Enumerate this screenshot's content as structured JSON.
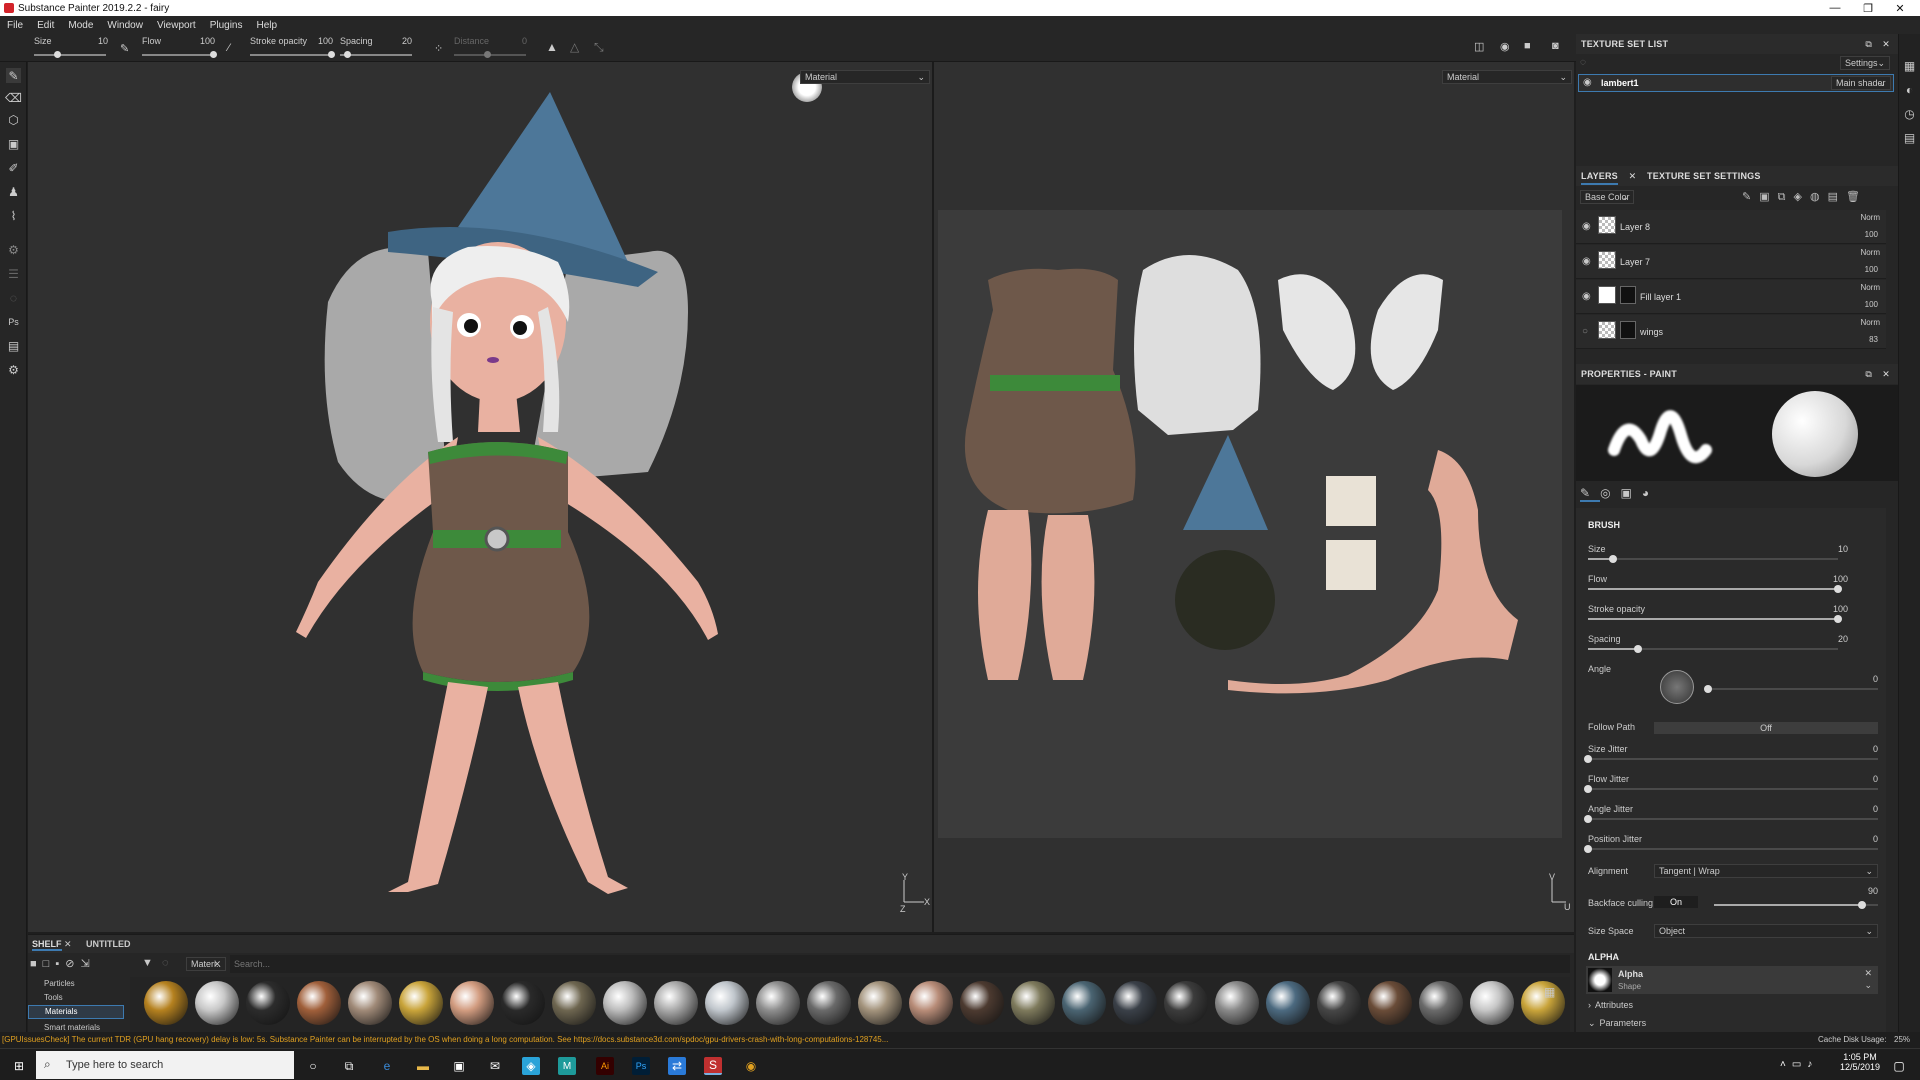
{
  "window": {
    "title": "Substance Painter 2019.2.2 - fairy",
    "minimize": "—",
    "maximize": "❐",
    "close": "✕"
  },
  "menu": [
    "File",
    "Edit",
    "Mode",
    "Window",
    "Viewport",
    "Plugins",
    "Help"
  ],
  "toolbar": {
    "size_label": "Size",
    "size_value": "10",
    "flow_label": "Flow",
    "flow_value": "100",
    "stroke_opacity_label": "Stroke opacity",
    "stroke_opacity_value": "100",
    "spacing_label": "Spacing",
    "spacing_value": "20",
    "distance_label": "Distance",
    "distance_value": "0"
  },
  "viewport": {
    "left_dropdown": "Material",
    "right_dropdown": "Material",
    "axis_y": "Y",
    "axis_x": "X",
    "axis_z": "Z",
    "axis_v": "V",
    "axis_u": "U"
  },
  "texture_set_list": {
    "title": "TEXTURE SET LIST",
    "settings_button": "Settings",
    "item_name": "lambert1",
    "shader": "Main shader"
  },
  "layers_panel": {
    "tab_layers": "LAYERS",
    "tab_settings": "TEXTURE SET SETTINGS",
    "channel": "Base Color",
    "layers": [
      {
        "name": "Layer 8",
        "blend": "Norm",
        "opacity": "100"
      },
      {
        "name": "Layer 7",
        "blend": "Norm",
        "opacity": "100"
      },
      {
        "name": "Fill layer 1",
        "blend": "Norm",
        "opacity": "100"
      },
      {
        "name": "wings",
        "blend": "Norm",
        "opacity": "83"
      }
    ]
  },
  "properties": {
    "title": "PROPERTIES - PAINT",
    "brush_header": "BRUSH",
    "size": {
      "label": "Size",
      "value": "10",
      "fraction": 0.1
    },
    "flow": {
      "label": "Flow",
      "value": "100",
      "fraction": 1.0
    },
    "stroke_opacity": {
      "label": "Stroke opacity",
      "value": "100",
      "fraction": 1.0
    },
    "spacing": {
      "label": "Spacing",
      "value": "20",
      "fraction": 0.2
    },
    "angle": {
      "label": "Angle",
      "value": "0"
    },
    "follow_path": {
      "label": "Follow Path",
      "value": "Off"
    },
    "size_jitter": {
      "label": "Size Jitter",
      "value": "0"
    },
    "flow_jitter": {
      "label": "Flow Jitter",
      "value": "0"
    },
    "angle_jitter": {
      "label": "Angle Jitter",
      "value": "0"
    },
    "position_jitter": {
      "label": "Position Jitter",
      "value": "0"
    },
    "alignment": {
      "label": "Alignment",
      "value": "Tangent | Wrap"
    },
    "backface": {
      "label": "Backface culling",
      "toggle": "On",
      "value": "90",
      "fraction": 0.9
    },
    "size_space": {
      "label": "Size Space",
      "value": "Object"
    },
    "alpha_header": "ALPHA",
    "alpha_name": "Alpha",
    "alpha_type": "Shape",
    "attributes": "Attributes",
    "parameters": "Parameters"
  },
  "shelf": {
    "tab_shelf": "SHELF",
    "tab_untitled": "UNTITLED",
    "filter_tag": "Materi..",
    "search_placeholder": "Search...",
    "categories": [
      "Particles",
      "Tools",
      "Materials",
      "Smart materials"
    ],
    "materials": [
      "#b5811f",
      "#c8c8c8",
      "#2c2c2c",
      "#a05f3a",
      "#a08a78",
      "#c9a43a",
      "#d29c80",
      "#2a2a2a",
      "#6e6650",
      "#bcbcbc",
      "#aaaaaa",
      "#c0c6cc",
      "#8e8e8e",
      "#6a6a6a",
      "#a3937c",
      "#b88c78",
      "#4c3a30",
      "#7e7a5c",
      "#4a6472",
      "#3a4048",
      "#3c3c3c",
      "#8a8a8a",
      "#4c6a80",
      "#464646",
      "#6a4c38",
      "#6a6a6a",
      "#c6c6c6",
      "#c9a43a"
    ]
  },
  "status": {
    "message": "[GPUIssuesCheck] The current TDR (GPU hang recovery) delay is low: 5s. Substance Painter can be interrupted by the OS when doing a long computation. See https://docs.substance3d.com/spdoc/gpu-drivers-crash-with-long-computations-128745...",
    "cache_label": "Cache Disk Usage:",
    "cache_value": "25%"
  },
  "taskbar": {
    "search_placeholder": "Type here to search",
    "time": "1:05 PM",
    "date": "12/5/2019"
  }
}
